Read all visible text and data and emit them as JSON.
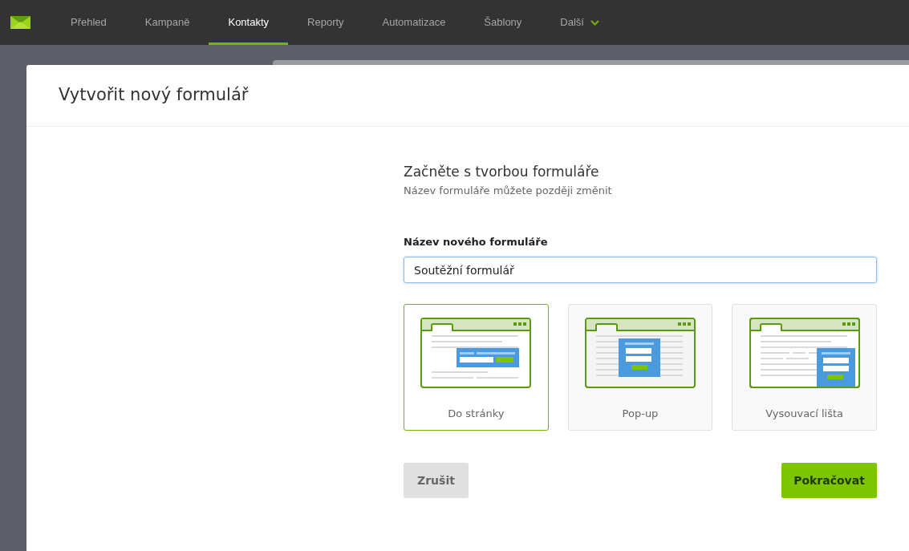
{
  "nav": {
    "items": [
      {
        "label": "Přehled",
        "selected": false
      },
      {
        "label": "Kampaně",
        "selected": false
      },
      {
        "label": "Kontakty",
        "selected": true
      },
      {
        "label": "Reporty",
        "selected": false
      },
      {
        "label": "Automatizace",
        "selected": false
      },
      {
        "label": "Šablony",
        "selected": false
      }
    ],
    "more": "Další"
  },
  "dialog": {
    "title": "Vytvořit nový formulář",
    "heading": "Začněte s tvorbou formuláře",
    "subheading": "Název formuláře můžete později změnit",
    "field_label": "Název nového formuláře",
    "field_value": "Soutěžní formulář",
    "types": [
      {
        "kind": "inline",
        "label": "Do stránky",
        "selected": true
      },
      {
        "kind": "popup",
        "label": "Pop-up",
        "selected": false
      },
      {
        "kind": "slide",
        "label": "Vysouvací lišta",
        "selected": false
      }
    ],
    "cancel": "Zrušit",
    "continue": "Pokračovat"
  }
}
